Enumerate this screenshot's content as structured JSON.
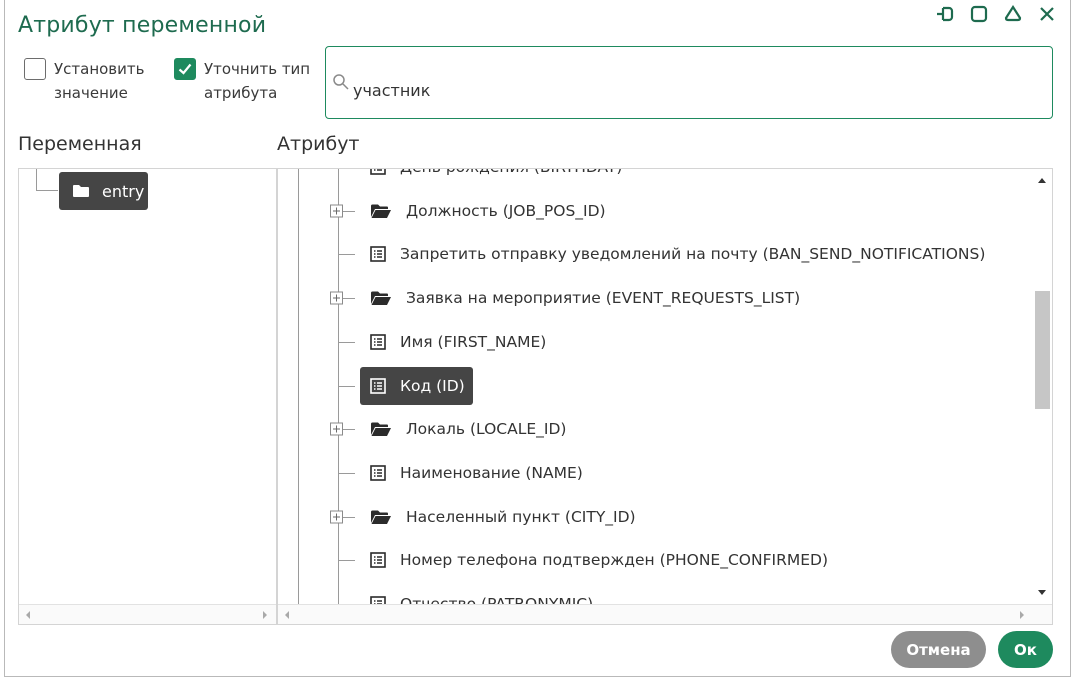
{
  "dialog": {
    "title": "Атрибут переменной"
  },
  "window_controls": [
    "pin-icon",
    "maximize-icon",
    "collapse-icon",
    "close-icon"
  ],
  "options": {
    "set_value": {
      "label": "Установить значение",
      "checked": false
    },
    "refine_type": {
      "label": "Уточнить тип атрибута",
      "checked": true
    }
  },
  "search": {
    "value": "участник",
    "placeholder": ""
  },
  "variable_panel": {
    "label": "Переменная",
    "items": [
      {
        "label": "entry",
        "icon": "folder-icon",
        "selected": true
      }
    ]
  },
  "attribute_panel": {
    "label": "Атрибут",
    "items": [
      {
        "label": "День рождения (BIRTHDAY)",
        "icon": "list-icon",
        "expandable": false,
        "selected": false
      },
      {
        "label": "Должность (JOB_POS_ID)",
        "icon": "folder-open-icon",
        "expandable": true,
        "selected": false
      },
      {
        "label": "Запретить отправку уведомлений на почту (BAN_SEND_NOTIFICATIONS)",
        "icon": "list-icon",
        "expandable": false,
        "selected": false
      },
      {
        "label": "Заявка на мероприятие (EVENT_REQUESTS_LIST)",
        "icon": "folder-open-icon",
        "expandable": true,
        "selected": false
      },
      {
        "label": "Имя (FIRST_NAME)",
        "icon": "list-icon",
        "expandable": false,
        "selected": false
      },
      {
        "label": "Код (ID)",
        "icon": "list-icon",
        "expandable": false,
        "selected": true
      },
      {
        "label": "Локаль (LOCALE_ID)",
        "icon": "folder-open-icon",
        "expandable": true,
        "selected": false
      },
      {
        "label": "Наименование (NAME)",
        "icon": "list-icon",
        "expandable": false,
        "selected": false
      },
      {
        "label": "Населенный пункт (CITY_ID)",
        "icon": "folder-open-icon",
        "expandable": true,
        "selected": false
      },
      {
        "label": "Номер телефона подтвержден (PHONE_CONFIRMED)",
        "icon": "list-icon",
        "expandable": false,
        "selected": false
      },
      {
        "label": "Отчество (PATRONYMIC)",
        "icon": "list-icon",
        "expandable": false,
        "selected": false
      }
    ]
  },
  "buttons": {
    "cancel": "Отмена",
    "ok": "Ок"
  },
  "colors": {
    "accent": "#1e8a5e",
    "title": "#1e6b4f",
    "selected_bg": "#454545",
    "cancel_bg": "#8e8e8e"
  }
}
